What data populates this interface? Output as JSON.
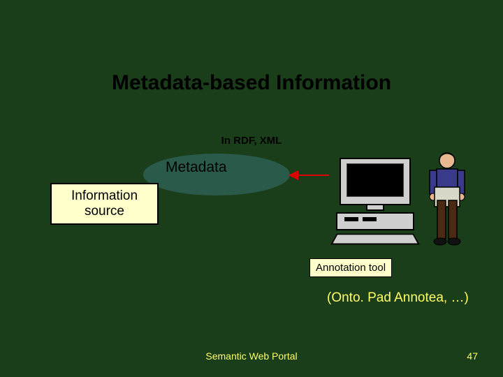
{
  "slide": {
    "title": "Metadata-based Information",
    "subtitle": "In RDF, XML"
  },
  "metadata_label": "Metadata",
  "info_source": "Information\nsource",
  "annotation_tool": "Annotation tool",
  "examples": "(Onto. Pad Annotea, …)",
  "footer": {
    "title": "Semantic Web Portal",
    "page": "47"
  }
}
